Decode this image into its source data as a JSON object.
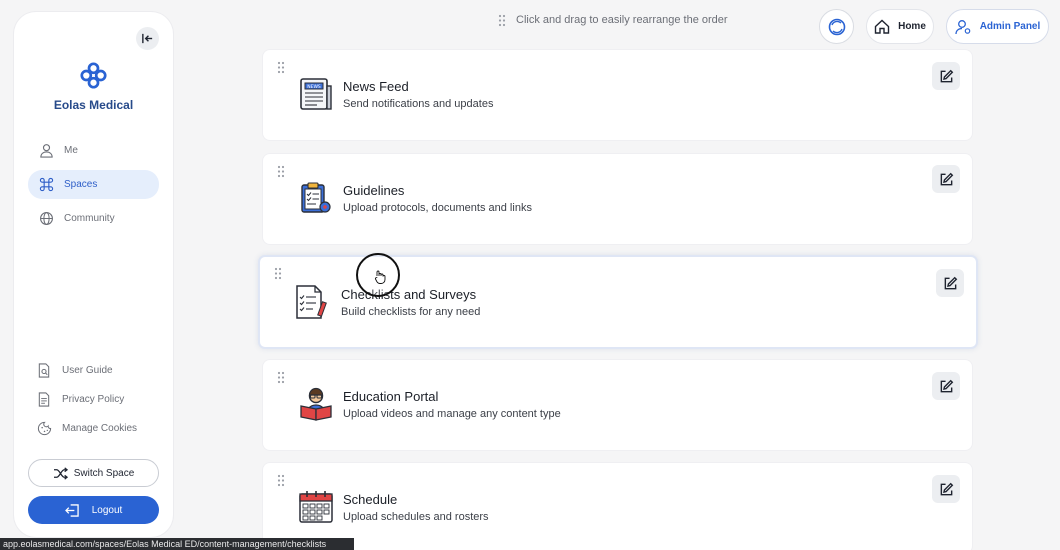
{
  "sidebar": {
    "brand_name": "Eolas Medical",
    "nav": [
      {
        "label": "Me",
        "icon": "user-icon"
      },
      {
        "label": "Spaces",
        "icon": "command-icon",
        "active": true
      },
      {
        "label": "Community",
        "icon": "globe-icon"
      }
    ],
    "footer_links": [
      {
        "label": "User Guide",
        "icon": "document-search-icon"
      },
      {
        "label": "Privacy Policy",
        "icon": "document-icon"
      },
      {
        "label": "Manage Cookies",
        "icon": "cookie-icon"
      }
    ],
    "switch_space_label": "Switch Space",
    "logout_label": "Logout"
  },
  "topbar": {
    "drag_hint": "Click and drag to easily rearrange the order",
    "home_label": "Home",
    "admin_label": "Admin Panel"
  },
  "cards": [
    {
      "title": "News Feed",
      "description": "Send notifications and updates",
      "icon": "newspaper-icon"
    },
    {
      "title": "Guidelines",
      "description": "Upload protocols, documents and links",
      "icon": "clipboard-icon"
    },
    {
      "title": "Checklists and Surveys",
      "description": "Build checklists for any need",
      "icon": "checklist-icon"
    },
    {
      "title": "Education Portal",
      "description": "Upload videos and manage any content type",
      "icon": "reader-icon"
    },
    {
      "title": "Schedule",
      "description": "Upload schedules and rosters",
      "icon": "calendar-icon"
    }
  ],
  "status_url": "app.eolasmedical.com/spaces/Eolas Medical ED/content-management/checklists",
  "colors": {
    "accent": "#2a63d3",
    "brand": "#274a8a",
    "active_nav_bg": "#e5eefc"
  }
}
